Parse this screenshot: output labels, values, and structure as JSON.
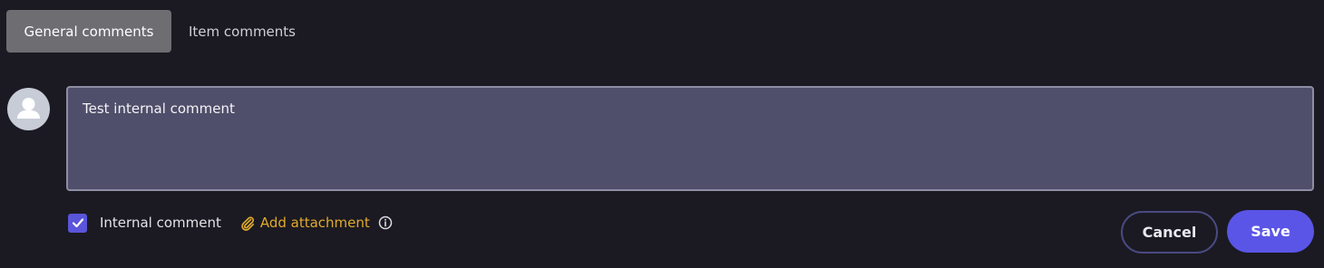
{
  "tabs": [
    {
      "label": "General comments",
      "active": true
    },
    {
      "label": "Item comments",
      "active": false
    }
  ],
  "comment": {
    "value": "Test internal comment"
  },
  "options": {
    "internal_comment_label": "Internal comment",
    "internal_comment_checked": true,
    "add_attachment_label": "Add attachment"
  },
  "actions": {
    "cancel_label": "Cancel",
    "save_label": "Save"
  },
  "colors": {
    "background": "#1b1a22",
    "accent": "#5a55e6",
    "attachment": "#e0aa2c",
    "input_bg": "#4f4f6b"
  },
  "icons": {
    "avatar": "user-avatar-icon",
    "checkbox": "check-icon",
    "attachment": "paperclip-icon",
    "info": "info-icon"
  }
}
